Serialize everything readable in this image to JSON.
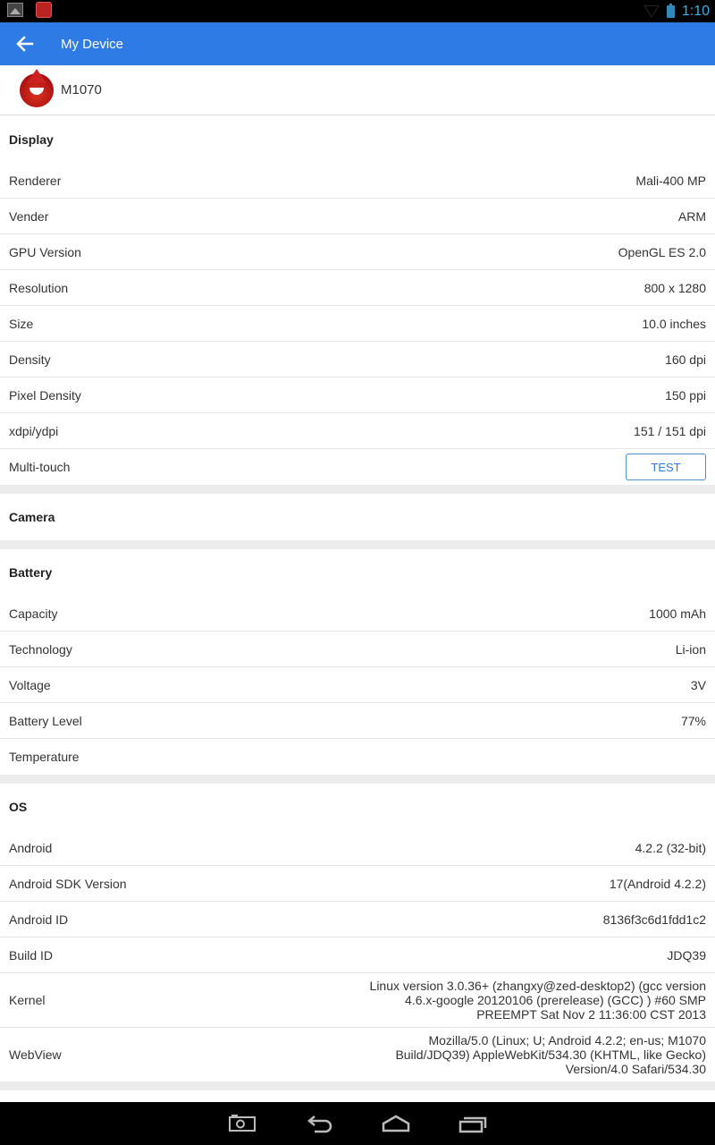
{
  "status_bar": {
    "time": "1:10"
  },
  "app_bar": {
    "title": "My Device"
  },
  "device": {
    "name": "M1070"
  },
  "sections": {
    "display": {
      "title": "Display",
      "rows": [
        {
          "label": "Renderer",
          "value": "Mali-400 MP"
        },
        {
          "label": "Vender",
          "value": "ARM"
        },
        {
          "label": "GPU Version",
          "value": "OpenGL ES 2.0"
        },
        {
          "label": "Resolution",
          "value": "800 x 1280"
        },
        {
          "label": "Size",
          "value": "10.0 inches"
        },
        {
          "label": "Density",
          "value": "160 dpi"
        },
        {
          "label": "Pixel Density",
          "value": "150 ppi"
        },
        {
          "label": "xdpi/ydpi",
          "value": "151 / 151 dpi"
        },
        {
          "label": "Multi-touch",
          "button": "TEST"
        }
      ]
    },
    "camera": {
      "title": "Camera"
    },
    "battery": {
      "title": "Battery",
      "rows": [
        {
          "label": "Capacity",
          "value": "1000 mAh"
        },
        {
          "label": "Technology",
          "value": "Li-ion"
        },
        {
          "label": "Voltage",
          "value": "3V"
        },
        {
          "label": "Battery Level",
          "value": "77%"
        },
        {
          "label": "Temperature",
          "value": ""
        }
      ]
    },
    "os": {
      "title": "OS",
      "rows": [
        {
          "label": "Android",
          "value": "4.2.2 (32-bit)"
        },
        {
          "label": "Android SDK Version",
          "value": "17(Android 4.2.2)"
        },
        {
          "label": "Android ID",
          "value": "8136f3c6d1fdd1c2"
        },
        {
          "label": "Build ID",
          "value": "JDQ39"
        },
        {
          "label": "Kernel",
          "value": "Linux version 3.0.36+ (zhangxy@zed-desktop2) (gcc version 4.6.x-google 20120106 (prerelease) (GCC) ) #60 SMP PREEMPT Sat Nov 2 11:36:00 CST 2013"
        },
        {
          "label": "WebView",
          "value": "Mozilla/5.0 (Linux; U; Android 4.2.2; en-us; M1070 Build/JDQ39) AppleWebKit/534.30 (KHTML, like Gecko) Version/4.0 Safari/534.30"
        }
      ]
    }
  },
  "icons": {
    "back": "arrow-left-icon",
    "nav_recent": "recent-apps-icon",
    "nav_back": "back-nav-icon",
    "nav_home": "home-icon",
    "nav_screenshot": "camera-icon"
  },
  "colors": {
    "accent": "#2f7be5",
    "clock": "#33b5e5"
  }
}
